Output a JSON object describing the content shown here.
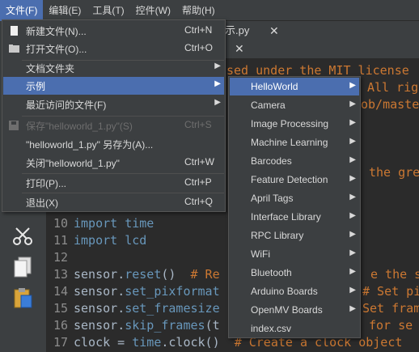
{
  "menubar": {
    "items": [
      {
        "label": "文件(F)"
      },
      {
        "label": "编辑(E)"
      },
      {
        "label": "工具(T)"
      },
      {
        "label": "控件(W)"
      },
      {
        "label": "帮助(H)"
      }
    ]
  },
  "tabs": {
    "first_label_fragment": "示.py",
    "close_glyph": "✕"
  },
  "file_menu": {
    "items": [
      {
        "label": "新建文件(N)...",
        "shortcut": "Ctrl+N"
      },
      {
        "label": "打开文件(O)...",
        "shortcut": "Ctrl+O"
      },
      {
        "label": "文档文件夹"
      },
      {
        "label": "示例"
      },
      {
        "label": "最近访问的文件(F)"
      },
      {
        "label": "保存\"helloworld_1.py\"(S)",
        "shortcut": "Ctrl+S"
      },
      {
        "label": "\"helloworld_1.py\" 另存为(A)..."
      },
      {
        "label": "关闭\"helloworld_1.py\"",
        "shortcut": "Ctrl+W"
      },
      {
        "label": "打印(P)...",
        "shortcut": "Ctrl+P"
      },
      {
        "label": "退出(X)",
        "shortcut": "Ctrl+Q"
      }
    ]
  },
  "examples_submenu": {
    "items": [
      {
        "label": "HelloWorld"
      },
      {
        "label": "Camera"
      },
      {
        "label": "Image Processing"
      },
      {
        "label": "Machine Learning"
      },
      {
        "label": "Barcodes"
      },
      {
        "label": "Feature Detection"
      },
      {
        "label": "April Tags"
      },
      {
        "label": "Interface Library"
      },
      {
        "label": "RPC Library"
      },
      {
        "label": "WiFi"
      },
      {
        "label": "Bluetooth"
      },
      {
        "label": "Arduino Boards"
      },
      {
        "label": "OpenMV Boards"
      },
      {
        "label": "index.csv"
      }
    ],
    "arrow_glyph": "▶"
  },
  "editor": {
    "top_fragments": {
      "line_a": "sed under the MIT license",
      "line_b": "All rig",
      "line_c": "ob/maste",
      "line_d": "the gre"
    },
    "lines": [
      {
        "num": "10",
        "parts": [
          {
            "t": "import",
            "c": "kw"
          },
          {
            "t": " time",
            "c": "kw"
          }
        ]
      },
      {
        "num": "11",
        "parts": [
          {
            "t": "import",
            "c": "kw"
          },
          {
            "t": " lcd",
            "c": "kw"
          }
        ]
      },
      {
        "num": "12",
        "parts": []
      },
      {
        "num": "13",
        "parts": [
          {
            "t": "sensor",
            "c": "tx"
          },
          {
            "t": ".",
            "c": "tx"
          },
          {
            "t": "reset",
            "c": "kw"
          },
          {
            "t": "()  ",
            "c": "tx"
          },
          {
            "t": "# Re",
            "c": "cm"
          }
        ]
      },
      {
        "num": "14",
        "parts": [
          {
            "t": "sensor",
            "c": "tx"
          },
          {
            "t": ".",
            "c": "tx"
          },
          {
            "t": "set_pixformat",
            "c": "kw"
          }
        ]
      },
      {
        "num": "15",
        "parts": [
          {
            "t": "sensor",
            "c": "tx"
          },
          {
            "t": ".",
            "c": "tx"
          },
          {
            "t": "set_framesize",
            "c": "kw"
          }
        ]
      },
      {
        "num": "16",
        "parts": [
          {
            "t": "sensor",
            "c": "tx"
          },
          {
            "t": ".",
            "c": "tx"
          },
          {
            "t": "skip_frames",
            "c": "kw"
          },
          {
            "t": "(t",
            "c": "tx"
          }
        ]
      },
      {
        "num": "17",
        "parts": [
          {
            "t": "clock",
            "c": "tx"
          },
          {
            "t": " = ",
            "c": "tx"
          },
          {
            "t": "time",
            "c": "kw"
          },
          {
            "t": ".clock()  ",
            "c": "tx"
          },
          {
            "t": "# Create a clock object",
            "c": "cm"
          }
        ]
      }
    ],
    "right_fragments": {
      "l13": "e the se",
      "l14": "# Set pi",
      "l15": "Set fram",
      "l16": "for se"
    }
  }
}
